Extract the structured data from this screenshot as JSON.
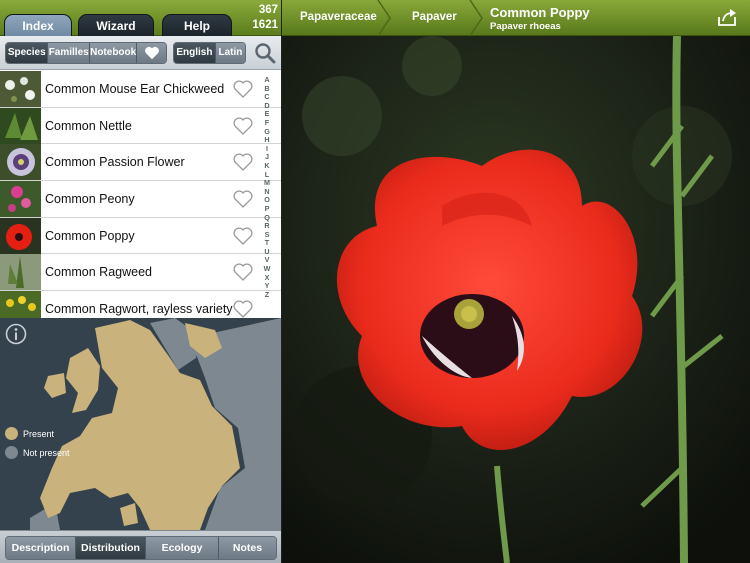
{
  "tabs": [
    "Index",
    "Wizard",
    "Help"
  ],
  "counts": [
    "367",
    "1621"
  ],
  "filters": {
    "category": [
      "Species",
      "Familles",
      "Notebook"
    ],
    "language": [
      "English",
      "Latin"
    ]
  },
  "species": [
    "Common Mouse Ear Chickweed",
    "Common Nettle",
    "Common Passion Flower",
    "Common Peony",
    "Common Poppy",
    "Common Ragweed",
    "Common Ragwort, rayless variety"
  ],
  "alphabet": [
    "A",
    "B",
    "C",
    "D",
    "E",
    "F",
    "G",
    "H",
    "I",
    "J",
    "K",
    "L",
    "M",
    "N",
    "O",
    "P",
    "Q",
    "R",
    "S",
    "T",
    "U",
    "V",
    "W",
    "X",
    "Y",
    "Z"
  ],
  "legend": {
    "present": "Present",
    "not_present": "Not present"
  },
  "detail_tabs": [
    "Description",
    "Distribution",
    "Ecology",
    "Notes"
  ],
  "breadcrumb": {
    "family": "Papaveraceae",
    "genus": "Papaver",
    "common_name": "Common Poppy",
    "latin_name": "Papaver rhoeas"
  },
  "colors": {
    "accent_green": "#6b8e23",
    "present": "#c9b27c",
    "not_present": "#7e8891",
    "map_sea": "#34424d"
  },
  "icons": [
    "search-icon",
    "heart-icon",
    "info-icon",
    "share-icon"
  ]
}
